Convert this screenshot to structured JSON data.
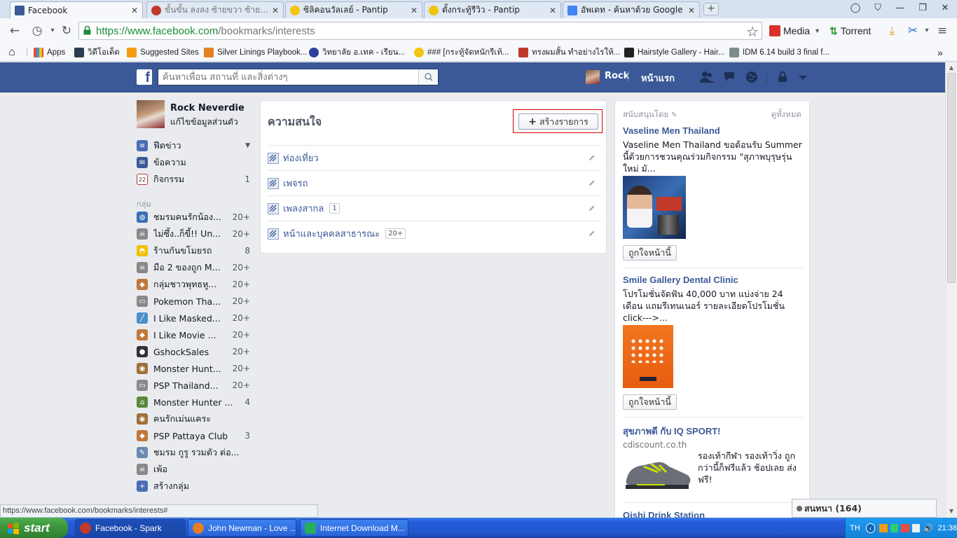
{
  "browser": {
    "tabs": [
      {
        "title": "Facebook",
        "active": true,
        "favicon_color": "#3b5998"
      },
      {
        "title": "ขั้นขั้น ลงลง ซ้ายขวา ซ้ายขวา C",
        "active": false,
        "favicon_color": "#c0392b"
      },
      {
        "title": "ซิลิคอนวัลเลย์ - Pantip",
        "active": false,
        "favicon_color": "#f1c40f"
      },
      {
        "title": "ตั้งกระทู้รีวิว - Pantip",
        "active": false,
        "favicon_color": "#f1c40f"
      },
      {
        "title": "อัพเดท - ค้นหาด้วย Google",
        "active": false,
        "favicon_color": "#4285f4"
      }
    ],
    "url_secure": "https://www.facebook.com",
    "url_path": "/bookmarks/interests",
    "extensions": {
      "media": "Media",
      "torrent": "Torrent"
    },
    "bookmarks": [
      {
        "label": "Apps",
        "color": "#e74c3c"
      },
      {
        "label": "วิดีโอเด็ด",
        "color": "#2c3e50"
      },
      {
        "label": "Suggested Sites",
        "color": "#f39c12"
      },
      {
        "label": "Silver Linings Playbook...",
        "color": "#e67e22"
      },
      {
        "label": "วิทยาลัย อ.เทค - เรียน...",
        "color": "#2c3e9e"
      },
      {
        "label": "### [กระทู้จัดหนักรีเท้...",
        "color": "#f1c40f"
      },
      {
        "label": "ทรงผมสั้น ทำอย่างไรให้...",
        "color": "#c0392b"
      },
      {
        "label": "Hairstyle Gallery - Hair...",
        "color": "#222222"
      },
      {
        "label": "IDM 6.14 build 3 final f...",
        "color": "#7f8c8d"
      }
    ],
    "more_bookmarks": "»"
  },
  "fb": {
    "search_placeholder": "ค้นหาเพื่อน สถานที่ และสิ่งต่างๆ",
    "nav_user": "Rock",
    "nav_home": "หน้าแรก",
    "brand_color": "#3b5998"
  },
  "sidebar": {
    "profile_name": "Rock Neverdie",
    "edit_profile": "แก้ไขข้อมูลส่วนตัว",
    "main": [
      {
        "label": "ฟีดข่าว",
        "count": "",
        "icon": "news-feed-icon",
        "color": "#4a6db5"
      },
      {
        "label": "ข้อความ",
        "count": "",
        "icon": "messages-icon",
        "color": "#3b5998"
      },
      {
        "label": "กิจกรรม",
        "count": "1",
        "icon": "events-icon",
        "color": "#b23b3b"
      }
    ],
    "groups_heading": "กลุ่ม",
    "groups": [
      {
        "label": "ชมรมคนรักน้อง...",
        "count": "20+",
        "icon": "globe-icon",
        "color": "#3b6eb5"
      },
      {
        "label": "ไม่ซึ้ง..ก็ขี้!! Un...",
        "count": "20+",
        "icon": "skull-icon",
        "color": "#888888"
      },
      {
        "label": "ร้านกันขโมยรถ",
        "count": "8",
        "icon": "bulb-icon",
        "color": "#f0c000"
      },
      {
        "label": "มือ 2 ของถูก M...",
        "count": "20+",
        "icon": "skull-icon",
        "color": "#888888"
      },
      {
        "label": "กลุ่มชาวพุทธหู...",
        "count": "20+",
        "icon": "fox-icon",
        "color": "#c0783a"
      },
      {
        "label": "Pokemon Tha...",
        "count": "20+",
        "icon": "gamepad-icon",
        "color": "#8a8a8a"
      },
      {
        "label": "I Like Masked...",
        "count": "20+",
        "icon": "pen-icon",
        "color": "#4a90c8"
      },
      {
        "label": "I Like Movie ...",
        "count": "20+",
        "icon": "fox-icon",
        "color": "#c0783a"
      },
      {
        "label": "GshockSales",
        "count": "20+",
        "icon": "soccer-icon",
        "color": "#333333"
      },
      {
        "label": "Monster Hunt...",
        "count": "20+",
        "icon": "cookie-icon",
        "color": "#a0703a"
      },
      {
        "label": "PSP Thailand...",
        "count": "20+",
        "icon": "gamepad-icon",
        "color": "#8a8a8a"
      },
      {
        "label": "Monster Hunter ...",
        "count": "4",
        "icon": "house-icon",
        "color": "#5a8a3a"
      },
      {
        "label": "คนรักเม่นแคระ",
        "count": "",
        "icon": "cookie-icon",
        "color": "#a0703a"
      },
      {
        "label": "PSP Pattaya Club",
        "count": "3",
        "icon": "fox-icon",
        "color": "#c0783a"
      },
      {
        "label": "ชมรม กูรู รวมตัว ต่อ...",
        "count": "",
        "icon": "tool-icon",
        "color": "#6a8ab0"
      },
      {
        "label": "เพ้อ",
        "count": "",
        "icon": "skull-icon",
        "color": "#888888"
      },
      {
        "label": "สร้างกลุ่ม",
        "count": "",
        "icon": "create-group-icon",
        "color": "#4a6db5"
      }
    ]
  },
  "interests": {
    "title": "ความสนใจ",
    "create_button": "สร้างรายการ",
    "lists": [
      {
        "label": "ท่องเที่ยว",
        "count": ""
      },
      {
        "label": "เพจรถ",
        "count": ""
      },
      {
        "label": "เพลงสากล",
        "count": "1"
      },
      {
        "label": "หน้าและบุคคลสาธารณะ",
        "count": "20+"
      }
    ]
  },
  "ads": {
    "sponsored": "สนับสนุนโดย",
    "see_all": "ดูทั้งหมด",
    "like_label": "ถูกใจหน้านี้",
    "items": [
      {
        "title": "Vaseline Men Thailand",
        "body": "Vaseline Men Thailand ขอต้อนรับ Summer นี้ด้วยการชวนคุณร่วมกิจกรรม \"สุภาพบุรุษรุ่นใหม่ มั...",
        "subtitle": ""
      },
      {
        "title": "Smile Gallery Dental Clinic",
        "body": "โปรโมชั่นจัดฟัน 40,000 บาท แบ่งจ่าย 24 เดือน แถมรีเทนเนอร์ รายละเอียดโปรโมชั่น click--->...",
        "subtitle": ""
      },
      {
        "title": "สุขภาพดี กับ IQ SPORT!",
        "body": "รองเท้ากีฬา รองเท้าวิ่ง ถูกกว่านี้ก็ฟรีแล้ว ช้อปเลย ส่งฟรี!",
        "subtitle": "cdiscount.co.th"
      },
      {
        "title": "Oishi Drink Station",
        "body": "",
        "subtitle": ""
      }
    ]
  },
  "status_url": "https://www.facebook.com/bookmarks/interests#",
  "chat": {
    "label": "สนทนา (164)"
  },
  "taskbar": {
    "start": "start",
    "tasks": [
      {
        "label": "Facebook - Spark",
        "active": true,
        "color": "#c0392b"
      },
      {
        "label": "John Newman - Love ...",
        "active": false,
        "color": "#e67e22"
      },
      {
        "label": "Internet Download M...",
        "active": false,
        "color": "#27ae60"
      }
    ],
    "lang": "TH",
    "clock": "21:38"
  }
}
